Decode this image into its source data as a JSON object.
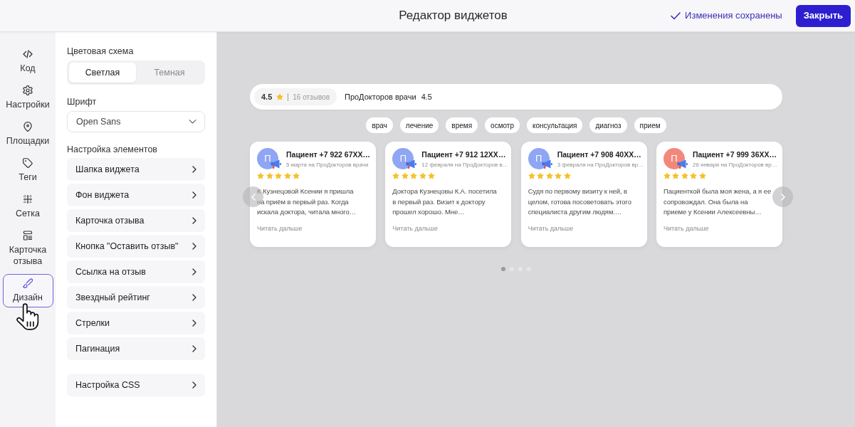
{
  "header": {
    "title": "Редактор виджетов",
    "save_status": "Изменения сохранены",
    "close_button": "Закрыть"
  },
  "nav": [
    {
      "label": "Код",
      "selected": false
    },
    {
      "label": "Настройки",
      "selected": false
    },
    {
      "label": "Площадки",
      "selected": false
    },
    {
      "label": "Теги",
      "selected": false
    },
    {
      "label": "Сетка",
      "selected": false
    },
    {
      "label": "Карточка отзыва",
      "selected": false
    },
    {
      "label": "Дизайн",
      "selected": true
    }
  ],
  "settings": {
    "color_scheme": {
      "label": "Цветовая схема",
      "options": [
        {
          "label": "Светлая",
          "selected": true
        },
        {
          "label": "Темная",
          "selected": false
        }
      ]
    },
    "font": {
      "label": "Шрифт",
      "value": "Open Sans"
    },
    "elements": {
      "label": "Настройка элементов",
      "items": [
        "Шапка виджета",
        "Фон виджета",
        "Карточка отзыва",
        "Кнопка \"Оставить отзыв\"",
        "Ссылка на отзыв",
        "Звездный рейтинг",
        "Стрелки",
        "Пагинация"
      ]
    },
    "css": {
      "label": "Настройка CSS"
    }
  },
  "preview": {
    "rating_badge": {
      "rating": "4.5",
      "count": "16 отзывов"
    },
    "source": {
      "name": "ПроДокторов врачи",
      "rating": "4.5"
    },
    "tags": [
      "врач",
      "лечение",
      "время",
      "осмотр",
      "консультация",
      "диагноз",
      "прием"
    ],
    "reviews": [
      {
        "initial": "П",
        "color": "#8ea6f3",
        "author": "Пациент +7 922 67XX…",
        "date": "5 марта на ПроДокторов врачи",
        "stars": 5,
        "text": "К Кузнецовой Ксении я пришла\nна приём в первый раз. Когда\nискала доктора, читала много…",
        "read_more": "Читать дальше"
      },
      {
        "initial": "П",
        "color": "#8ea6f3",
        "author": "Пациент +7 912 12XX…",
        "date": "12 февраля на ПроДокторов в…",
        "stars": 5,
        "text": "Доктора Кузнецовы К.А. посетила\nв первый раз. Визит к доктору\nпрошел хорошо. Мне…",
        "read_more": "Читать дальше"
      },
      {
        "initial": "П",
        "color": "#8ea6f3",
        "author": "Пациент +7 908 40XX…",
        "date": "3 февраля на ПроДокторов вр…",
        "stars": 5,
        "text": "Судя по первому визиту к ней, в\nцелом, готова посоветовать этого\nспециалиста другим людям.…",
        "read_more": "Читать дальше"
      },
      {
        "initial": "П",
        "color": "#f2887a",
        "author": "Пациент +7 999 36XX…",
        "date": "26 января на ПроДокторов вр…",
        "stars": 5,
        "text": "Пациенткой была моя жена, а я ее\nсопровождал. Она была на\nприеме у Ксении Алексеевны…",
        "read_more": "Читать дальше"
      }
    ],
    "pagination": [
      {
        "selected": true
      },
      {
        "selected": false
      },
      {
        "selected": false
      },
      {
        "selected": false
      }
    ]
  }
}
